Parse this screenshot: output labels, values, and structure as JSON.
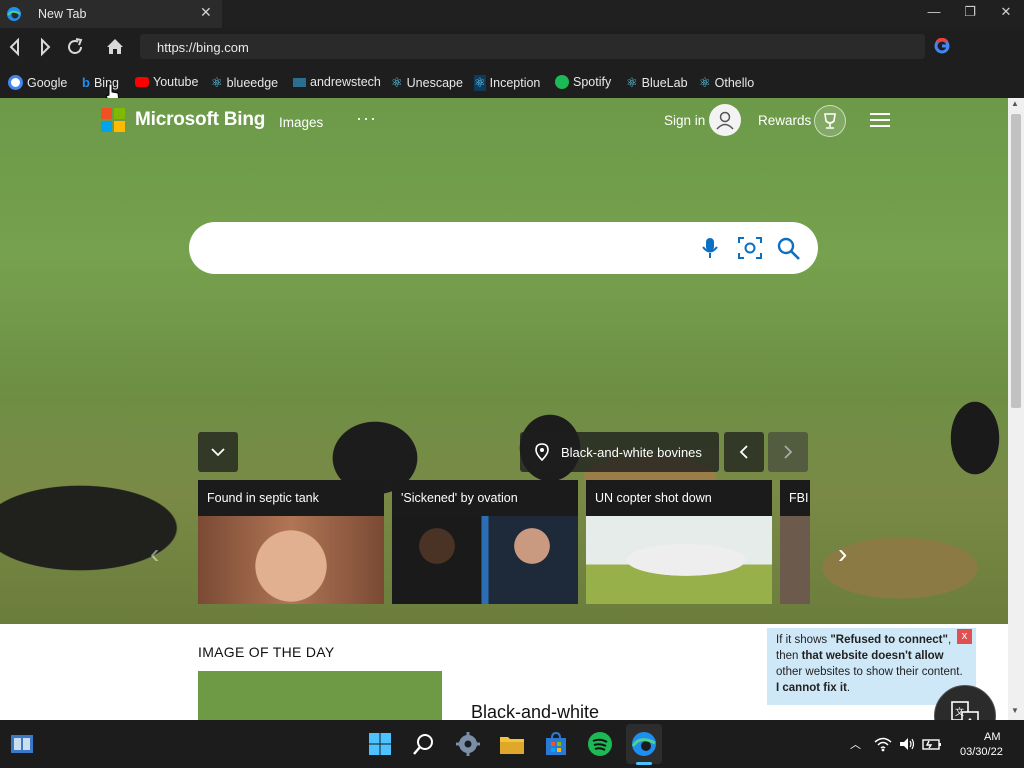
{
  "browser": {
    "tab_title": "New Tab",
    "url": "https://bing.com",
    "bookmarks": [
      {
        "label": "Google",
        "icon": "google-icon",
        "color": "#ffffff"
      },
      {
        "label": "Bing",
        "icon": "bing-icon",
        "color": "#1f8ef1"
      },
      {
        "label": "Youtube",
        "icon": "youtube-icon",
        "color": "#ff0000"
      },
      {
        "label": "blueedge",
        "icon": "react-icon",
        "color": "#61dafb"
      },
      {
        "label": "andrewstech",
        "icon": "site-icon",
        "color": "#2a6f8f"
      },
      {
        "label": "Unescape",
        "icon": "react-icon",
        "color": "#61dafb"
      },
      {
        "label": "Inception",
        "icon": "react-icon",
        "color": "#61dafb"
      },
      {
        "label": "Spotify",
        "icon": "spotify-icon",
        "color": "#1db954"
      },
      {
        "label": "BlueLab",
        "icon": "react-icon",
        "color": "#61dafb"
      },
      {
        "label": "Othello",
        "icon": "react-icon",
        "color": "#61dafb"
      }
    ]
  },
  "bing": {
    "logo_text": "Microsoft Bing",
    "nav_images": "Images",
    "nav_more": "···",
    "signin": "Sign in",
    "rewards": "Rewards",
    "search_placeholder": "",
    "caption": "Black-and-white bovines",
    "news": [
      {
        "title": "Found in septic tank"
      },
      {
        "title": "'Sickened' by ovation"
      },
      {
        "title": "UN copter shot down"
      },
      {
        "title": "FBI"
      }
    ],
    "iotd_heading": "IMAGE OF THE DAY",
    "iotd_title": "Black-and-white"
  },
  "tooltip": {
    "part1": "If it shows ",
    "bold1": "\"Refused to connect\"",
    "part2": ", then ",
    "bold2": "that website doesn't allow",
    "part3": " other websites to show their content. ",
    "bold3": "I cannot fix it",
    "part4": ".",
    "close": "x"
  },
  "taskbar": {
    "time": "AM",
    "date": "03/30/22"
  }
}
